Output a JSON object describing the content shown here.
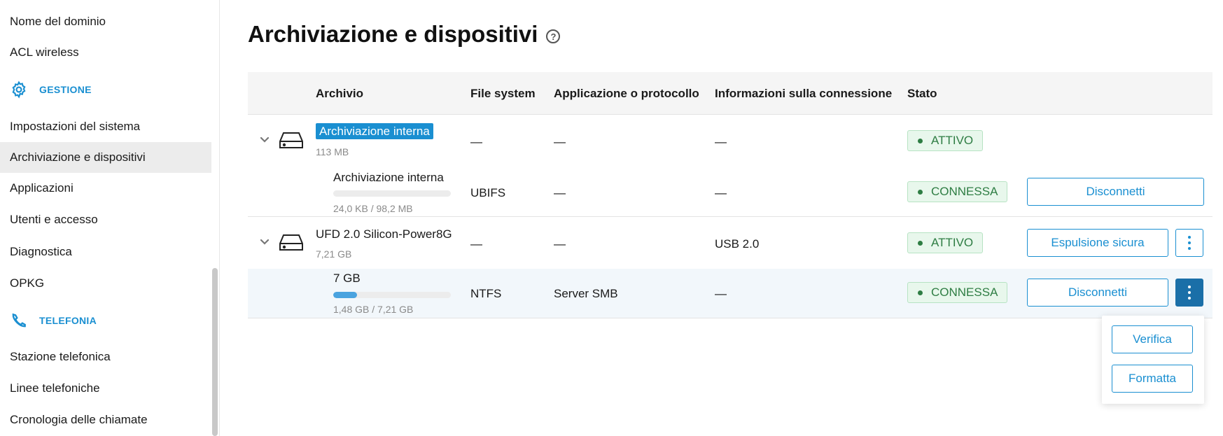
{
  "sidebar": {
    "items_top": [
      "Nome del dominio",
      "ACL wireless"
    ],
    "section_gestione": "GESTIONE",
    "items_gestione": [
      "Impostazioni del sistema",
      "Archiviazione e dispositivi",
      "Applicazioni",
      "Utenti e accesso",
      "Diagnostica",
      "OPKG"
    ],
    "section_telefonia": "TELEFONIA",
    "items_telefonia": [
      "Stazione telefonica",
      "Linee telefoniche",
      "Cronologia delle chiamate"
    ],
    "active_item": "Archiviazione e dispositivi"
  },
  "page": {
    "title": "Archiviazione e dispositivi",
    "help_glyph": "?"
  },
  "table": {
    "headers": {
      "archivio": "Archivio",
      "fs": "File system",
      "app": "Applicazione o protocollo",
      "conn": "Informazioni sulla connessione",
      "stato": "Stato"
    },
    "rows": [
      {
        "name": "Archiviazione interna",
        "size": "113 MB",
        "fs": "—",
        "app": "—",
        "conn": "—",
        "status": "ATTIVO",
        "partition": {
          "name": "Archiviazione interna",
          "usage": "24,0 KB / 98,2 MB",
          "fill_fraction": 0.0002,
          "fs": "UBIFS",
          "app": "—",
          "conn": "—",
          "status": "CONNESSA",
          "action": "Disconnetti"
        }
      },
      {
        "name": "UFD 2.0 Silicon-Power8G",
        "size": "7,21 GB",
        "fs": "—",
        "app": "—",
        "conn": "USB 2.0",
        "status": "ATTIVO",
        "action": "Espulsione sicura",
        "partition": {
          "name": "7 GB",
          "usage": "1,48 GB / 7,21 GB",
          "fill_fraction": 0.205,
          "fs": "NTFS",
          "app": "Server SMB",
          "conn": "—",
          "status": "CONNESSA",
          "action": "Disconnetti"
        }
      }
    ]
  },
  "dropdown_menu": {
    "items": [
      "Verifica",
      "Formatta"
    ]
  },
  "colors": {
    "accent": "#1a8fd1",
    "status_green": "#2e7d43",
    "status_bg": "#e8f7ec",
    "active_kebab": "#1a6fa8"
  }
}
